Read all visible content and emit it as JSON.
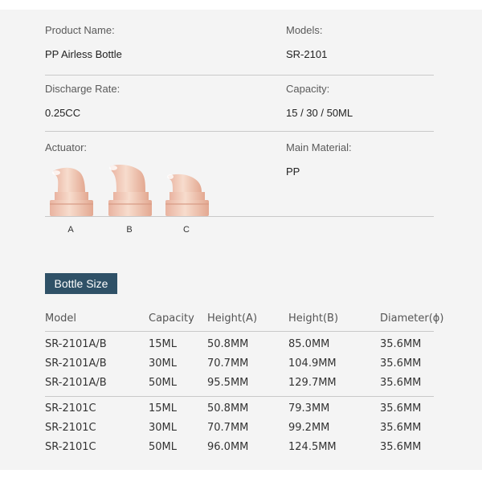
{
  "info": {
    "product_name_label": "Product Name:",
    "product_name": "PP Airless Bottle",
    "models_label": "Models:",
    "models": "SR-2101",
    "discharge_label": "Discharge Rate:",
    "discharge": "0.25CC",
    "capacity_label": "Capacity:",
    "capacity": "15 / 30 / 50ML",
    "actuator_label": "Actuator:",
    "actuators": [
      "A",
      "B",
      "C"
    ],
    "material_label": "Main Material:",
    "material": "PP"
  },
  "colors": {
    "section_bg": "#2f5167",
    "cap": "#f1c9b8",
    "panel": "#f4f4f4"
  },
  "size_table": {
    "title": "Bottle Size",
    "headers": [
      "Model",
      "Capacity",
      "Height(A)",
      "Height(B)",
      "Diameter(ϕ)"
    ],
    "group1": [
      [
        "SR-2101A/B",
        "15ML",
        "50.8MM",
        "85.0MM",
        "35.6MM"
      ],
      [
        "SR-2101A/B",
        "30ML",
        "70.7MM",
        "104.9MM",
        "35.6MM"
      ],
      [
        "SR-2101A/B",
        "50ML",
        "95.5MM",
        "129.7MM",
        "35.6MM"
      ]
    ],
    "group2": [
      [
        "SR-2101C",
        "15ML",
        "50.8MM",
        "79.3MM",
        "35.6MM"
      ],
      [
        "SR-2101C",
        "30ML",
        "70.7MM",
        "99.2MM",
        "35.6MM"
      ],
      [
        "SR-2101C",
        "50ML",
        "96.0MM",
        "124.5MM",
        "35.6MM"
      ]
    ]
  }
}
